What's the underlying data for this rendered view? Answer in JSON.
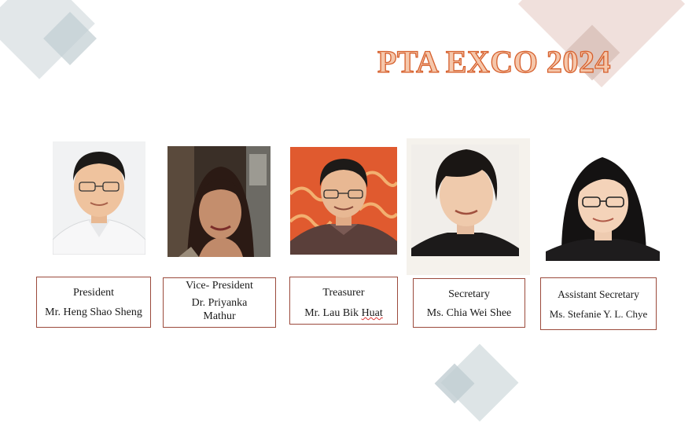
{
  "slide": {
    "title": "PTA EXCO 2024"
  },
  "members": [
    {
      "role": "President",
      "name": "Mr. Heng Shao Sheng"
    },
    {
      "role": "Vice- President",
      "name": "Dr. Priyanka Mathur"
    },
    {
      "role": "Treasurer",
      "name_prefix": "Mr. Lau Bik ",
      "name_flagged": "Huat"
    },
    {
      "role": "Secretary",
      "name": "Ms. Chia Wei Shee"
    },
    {
      "role": "Assistant Secretary",
      "name": "Ms. Stefanie Y. L. Chye"
    }
  ],
  "colors": {
    "title_fill": "#f5c7ab",
    "title_outline": "#d65f2c",
    "card_border": "#9b4a3c"
  }
}
